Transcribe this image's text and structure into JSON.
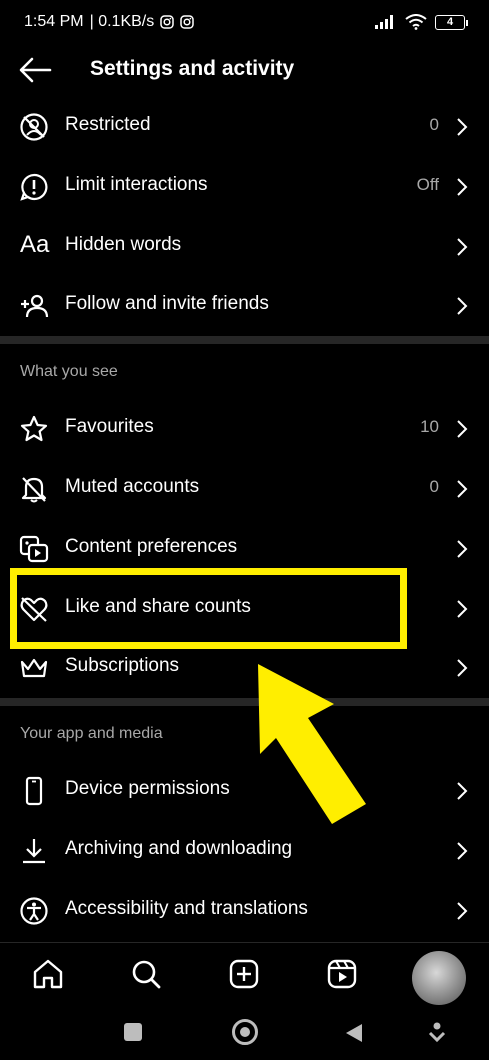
{
  "status_bar": {
    "time": "1:54 PM",
    "speed": "| 0.1KB/s",
    "battery": "4"
  },
  "header": {
    "title": "Settings and activity"
  },
  "rows": {
    "restricted": {
      "label": "Restricted",
      "value": "0"
    },
    "limit_interactions": {
      "label": "Limit interactions",
      "value": "Off"
    },
    "hidden_words": {
      "label": "Hidden words",
      "icon_text": "Aa"
    },
    "follow_invite": {
      "label": "Follow and invite friends"
    },
    "favourites": {
      "label": "Favourites",
      "value": "10"
    },
    "muted": {
      "label": "Muted accounts",
      "value": "0"
    },
    "content_prefs": {
      "label": "Content preferences"
    },
    "like_share": {
      "label": "Like and share counts"
    },
    "subscriptions": {
      "label": "Subscriptions"
    },
    "device_permissions": {
      "label": "Device permissions"
    },
    "archiving": {
      "label": "Archiving and downloading"
    },
    "accessibility": {
      "label": "Accessibility and translations"
    }
  },
  "sections": {
    "what_you_see": "What you see",
    "your_app": "Your app and media"
  },
  "annotation": {
    "highlight_color": "#ffee00"
  },
  "icons": {
    "back": "arrow-left-icon",
    "home": "home-icon",
    "search": "search-icon",
    "create": "plus-square-icon",
    "reels": "reels-icon"
  }
}
